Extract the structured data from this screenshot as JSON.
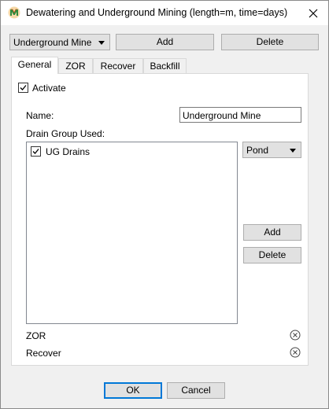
{
  "window": {
    "title": "Dewatering and Underground Mining (length=m, time=days)"
  },
  "top": {
    "mine_select_value": "Underground Mine",
    "add_label": "Add",
    "delete_label": "Delete"
  },
  "tabs": [
    {
      "label": "General"
    },
    {
      "label": "ZOR"
    },
    {
      "label": "Recover"
    },
    {
      "label": "Backfill"
    }
  ],
  "general": {
    "activate_label": "Activate",
    "activate_checked": true,
    "name_label": "Name:",
    "name_value": "Underground Mine",
    "drain_group_label": "Drain Group Used:",
    "drain_groups": [
      {
        "label": "UG Drains",
        "checked": true
      }
    ],
    "type_select_value": "Pond",
    "add_label": "Add",
    "delete_label": "Delete",
    "zor_label": "ZOR",
    "recover_label": "Recover"
  },
  "footer": {
    "ok_label": "OK",
    "cancel_label": "Cancel"
  }
}
